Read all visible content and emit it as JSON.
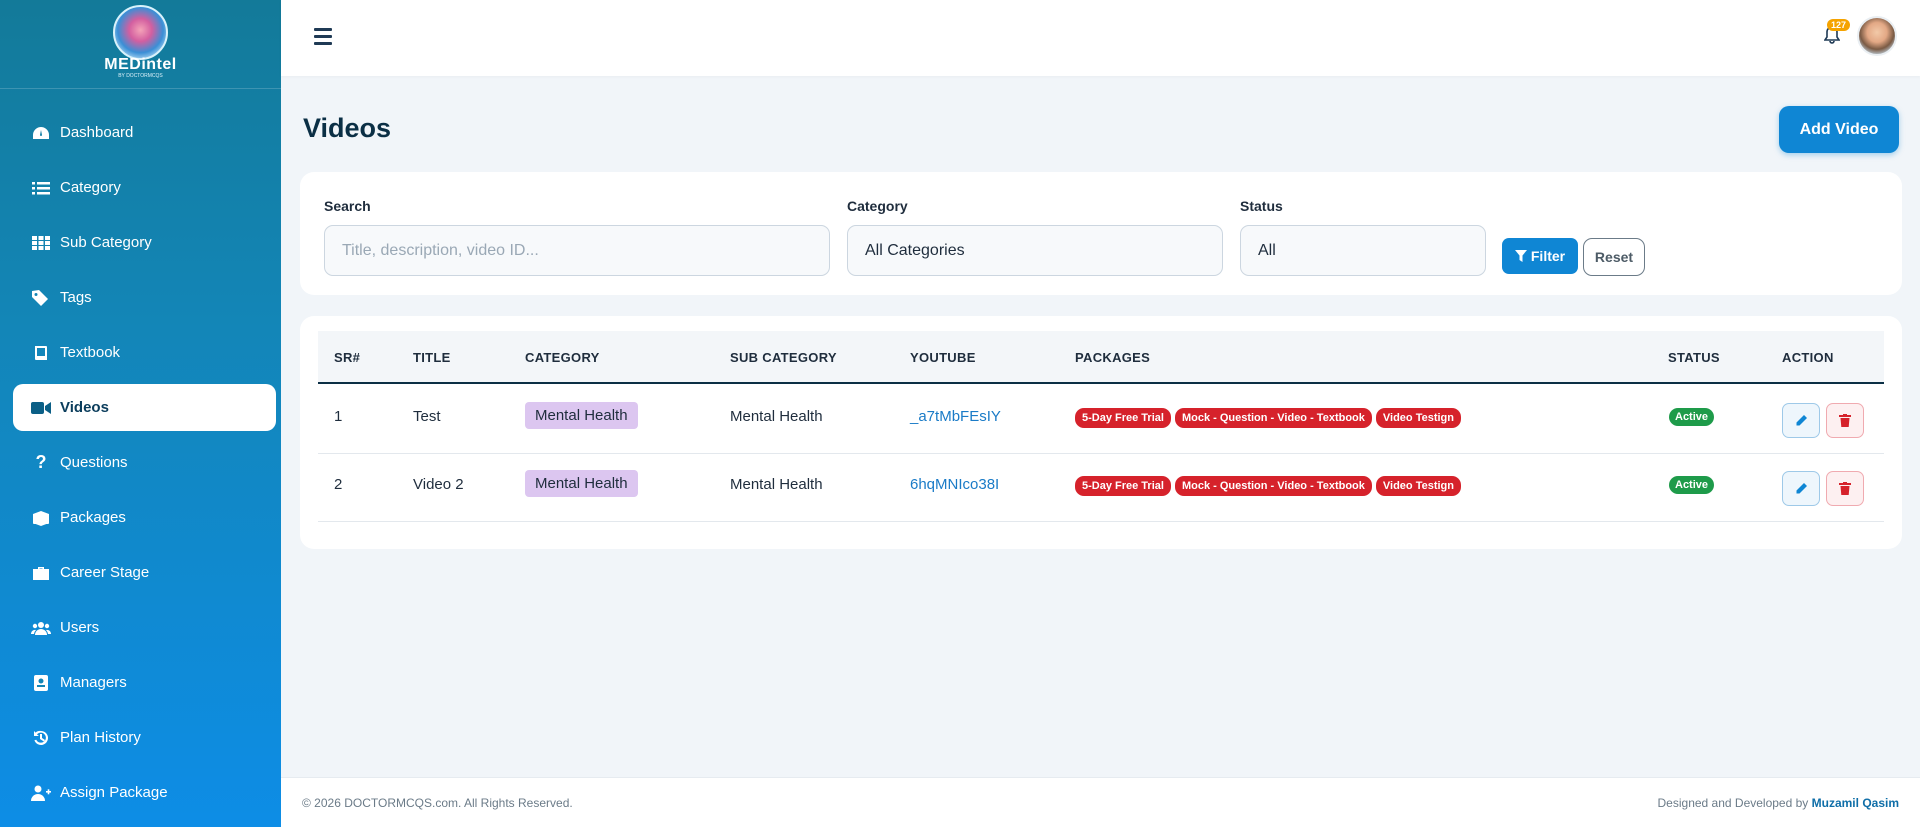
{
  "brand": {
    "name": "MEDintel",
    "tagline": "BY DOCTORMCQS"
  },
  "sidebar": {
    "items": [
      {
        "label": "Dashboard",
        "icon": "dashboard-icon"
      },
      {
        "label": "Category",
        "icon": "list-icon"
      },
      {
        "label": "Sub Category",
        "icon": "grid-icon"
      },
      {
        "label": "Tags",
        "icon": "tag-icon"
      },
      {
        "label": "Textbook",
        "icon": "book-icon"
      },
      {
        "label": "Videos",
        "icon": "video-icon",
        "active": true
      },
      {
        "label": "Questions",
        "icon": "question-icon"
      },
      {
        "label": "Packages",
        "icon": "box-icon"
      },
      {
        "label": "Career Stage",
        "icon": "briefcase-icon"
      },
      {
        "label": "Users",
        "icon": "users-icon"
      },
      {
        "label": "Managers",
        "icon": "id-badge-icon"
      },
      {
        "label": "Plan History",
        "icon": "history-icon"
      },
      {
        "label": "Assign Package",
        "icon": "user-plus-icon"
      }
    ]
  },
  "topbar": {
    "notification_count": "127"
  },
  "page": {
    "title": "Videos",
    "add_button": "Add Video"
  },
  "filters": {
    "search_label": "Search",
    "search_placeholder": "Title, description, video ID...",
    "category_label": "Category",
    "category_value": "All Categories",
    "status_label": "Status",
    "status_value": "All",
    "filter_button": "Filter",
    "reset_button": "Reset"
  },
  "table": {
    "headers": [
      "SR#",
      "TITLE",
      "CATEGORY",
      "SUB CATEGORY",
      "YOUTUBE",
      "PACKAGES",
      "STATUS",
      "ACTION"
    ],
    "rows": [
      {
        "sr": "1",
        "title": "Test",
        "category": "Mental Health",
        "sub_category": "Mental Health",
        "youtube": "_a7tMbFEsIY",
        "packages": [
          "5-Day Free Trial",
          "Mock - Question - Video - Textbook",
          "Video Testign"
        ],
        "status": "Active"
      },
      {
        "sr": "2",
        "title": "Video 2",
        "category": "Mental Health",
        "sub_category": "Mental Health",
        "youtube": "6hqMNIco38I",
        "packages": [
          "5-Day Free Trial",
          "Mock - Question - Video - Textbook",
          "Video Testign"
        ],
        "status": "Active"
      }
    ]
  },
  "footer": {
    "copyright": "© 2026 DOCTORMCQS.com. All Rights Reserved.",
    "credit_prefix": "Designed and Developed by",
    "credit_name": "Muzamil Qasim"
  },
  "colors": {
    "accent": "#0f86d4",
    "package_badge": "#d6222b",
    "status_active": "#1e9b4a",
    "category_pill": "#dcc6f0"
  }
}
